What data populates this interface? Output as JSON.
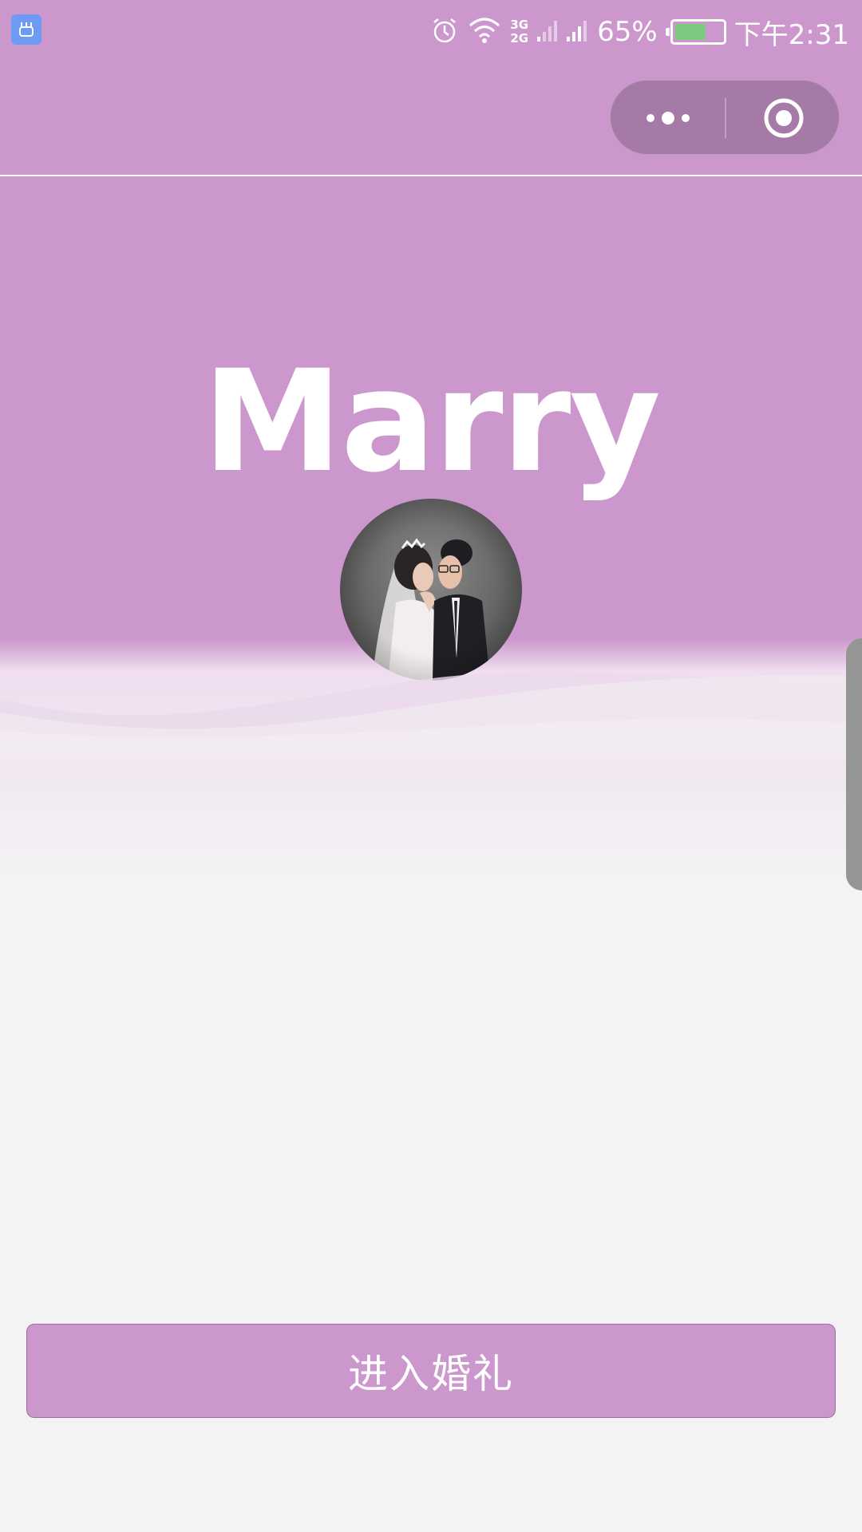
{
  "status_bar": {
    "battery_percent": "65%",
    "time": "下午2:31",
    "network_top": "3G",
    "network_bottom": "2G",
    "battery_level": 0.65,
    "icons": [
      "app-badge-icon",
      "alarm-icon",
      "wifi-icon",
      "signal-icon",
      "battery-icon"
    ]
  },
  "nav": {
    "more_icon": "more-dots-icon",
    "close_icon": "target-close-icon"
  },
  "hero": {
    "title": "Marry",
    "avatar_icon": "couple-photo"
  },
  "action": {
    "enter_label": "进入婚礼"
  },
  "colors": {
    "primary": "#cc97cc",
    "capsule": "#a57aa7",
    "background": "#f4f3f4",
    "button_border": "#a06aa3",
    "battery_fill": "#7fc87f"
  }
}
